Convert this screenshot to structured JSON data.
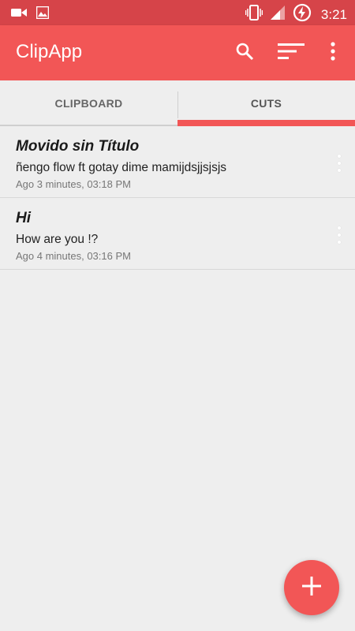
{
  "status_bar": {
    "time": "3:21",
    "left_icons": [
      "video-camera-icon",
      "image-icon"
    ],
    "right_icons": [
      "vibrate-icon",
      "signal-icon",
      "battery-charging-icon"
    ]
  },
  "app_bar": {
    "title": "ClipApp",
    "actions": [
      "search-icon",
      "sort-icon",
      "more-vert-icon"
    ]
  },
  "tabs": [
    {
      "label": "CLIPBOARD",
      "selected": false
    },
    {
      "label": "CUTS",
      "selected": true
    }
  ],
  "items": [
    {
      "title": "Movido sin Título",
      "body": "ñengo flow ft gotay dime mamijdsjjsjsjs",
      "date": "Ago 3 minutes, 03:18 PM"
    },
    {
      "title": "Hi",
      "body": "How are you !?",
      "date": "Ago 4 minutes, 03:16 PM"
    }
  ],
  "fab": {
    "icon": "plus-icon"
  },
  "colors": {
    "status_bar": "#d64449",
    "accent": "#f25656",
    "background": "#eeeeee"
  }
}
